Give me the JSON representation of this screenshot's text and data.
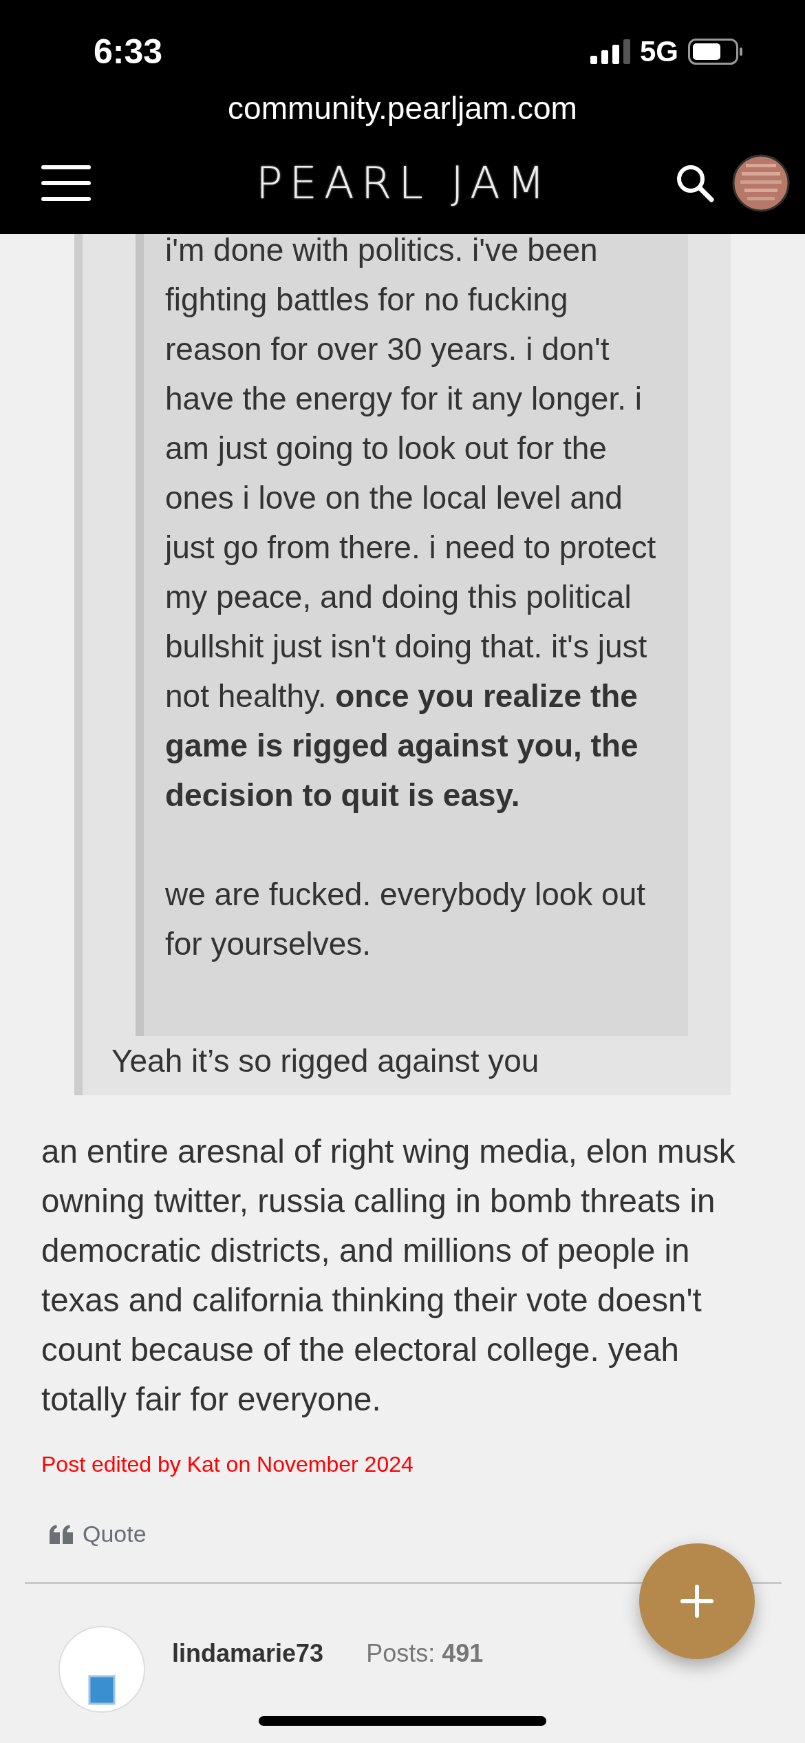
{
  "status_bar": {
    "time": "6:33",
    "network": "5G"
  },
  "browser": {
    "url": "community.pearljam.com"
  },
  "nav": {
    "logo": "PEARL JAM"
  },
  "post": {
    "quote": {
      "nested_quote": [
        "i'm done with politics. i've been fighting battles for no fucking reason for over 30 years. i don't have the energy for it any longer. i am just going to look out for the ones i love on the local level and just go from there. i need to protect my peace, and doing this political bullshit just isn't doing that. it's just not healthy. **once you realize the game is rigged against you, the decision to quit is easy.**",
        "we are fucked. everybody look out for yourselves."
      ],
      "text": "Yeah it’s so rigged against you"
    },
    "body": " an entire aresnal of right wing media, elon musk owning twitter, russia calling in bomb threats in democratic districts, and millions of people in texas and california thinking their vote doesn't count because of the electoral college. yeah totally fair for everyone.",
    "edited_note": "Post edited by Kat on November 2024",
    "quote_action": "Quote"
  },
  "next_post": {
    "author": "lindamarie73",
    "posts_label": "Posts:",
    "posts_count": "491"
  }
}
